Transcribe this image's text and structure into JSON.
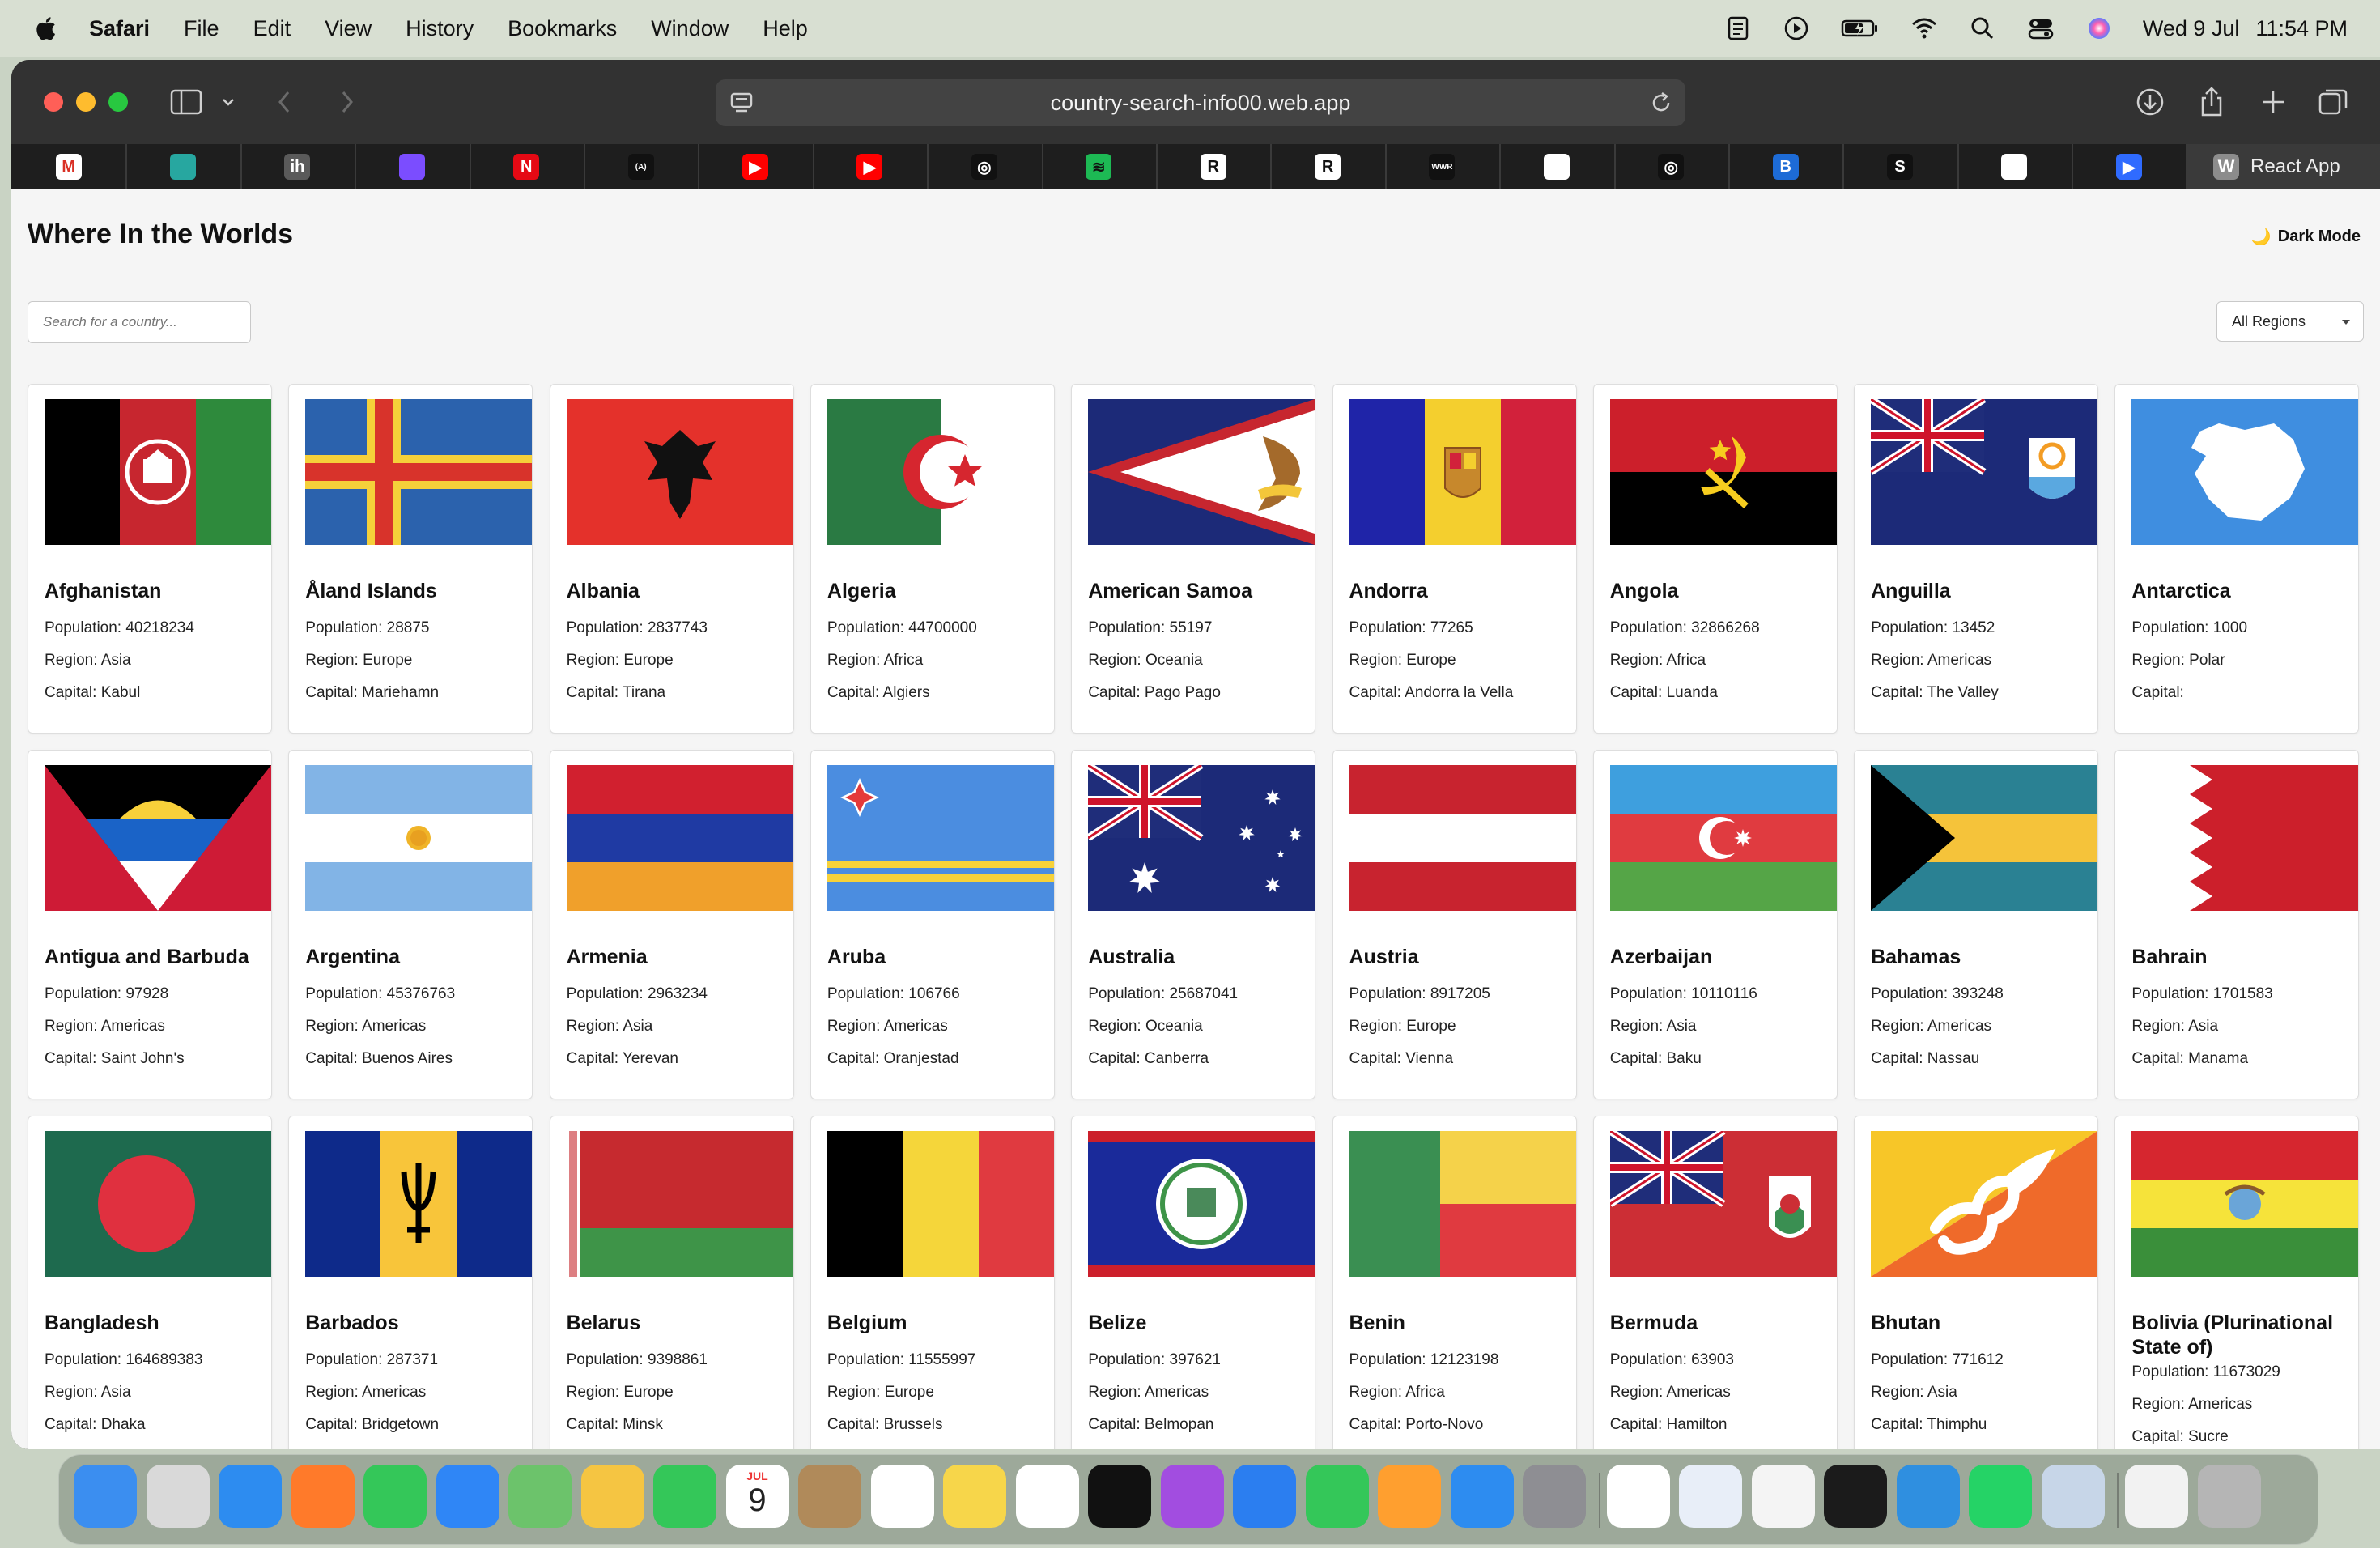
{
  "menubar": {
    "app_name": "Safari",
    "items": [
      "File",
      "Edit",
      "View",
      "History",
      "Bookmarks",
      "Window",
      "Help"
    ],
    "date": "Wed 9 Jul",
    "time": "11:54 PM"
  },
  "browser": {
    "url": "country-search-info00.web.app",
    "active_tab_title": "React App",
    "active_tab_icon_letter": "W",
    "favorite_tabs": [
      {
        "icon": "gmail-icon",
        "letter": "M",
        "color": "#ffffff",
        "text": "#d93025"
      },
      {
        "icon": "diamond-icon",
        "letter": "",
        "color": "#27a7a0",
        "text": "#fff"
      },
      {
        "icon": "ih-icon",
        "letter": "ih",
        "color": "#5a5a5a",
        "text": "#fff"
      },
      {
        "icon": "sparkle-icon",
        "letter": "",
        "color": "#7b4dff",
        "text": "#fff"
      },
      {
        "icon": "netflix-icon",
        "letter": "N",
        "color": "#e50914",
        "text": "#fff"
      },
      {
        "icon": "code-icon",
        "letter": "(A)",
        "color": "#111111",
        "text": "#fff"
      },
      {
        "icon": "youtube-icon",
        "letter": "▶",
        "color": "#ff0000",
        "text": "#fff"
      },
      {
        "icon": "youtube-icon",
        "letter": "▶",
        "color": "#ff0000",
        "text": "#fff"
      },
      {
        "icon": "openai-icon",
        "letter": "◎",
        "color": "#111111",
        "text": "#fff"
      },
      {
        "icon": "spotify-icon",
        "letter": "≋",
        "color": "#1db954",
        "text": "#111"
      },
      {
        "icon": "r-icon",
        "letter": "R",
        "color": "#ffffff",
        "text": "#111"
      },
      {
        "icon": "r-icon",
        "letter": "R",
        "color": "#ffffff",
        "text": "#111"
      },
      {
        "icon": "wwr-icon",
        "letter": "WWR",
        "color": "#111111",
        "text": "#fff"
      },
      {
        "icon": "page-icon",
        "letter": "",
        "color": "#ffffff",
        "text": "#111"
      },
      {
        "icon": "openai-icon",
        "letter": "◎",
        "color": "#111111",
        "text": "#fff"
      },
      {
        "icon": "b-icon",
        "letter": "B",
        "color": "#1d6bd6",
        "text": "#fff"
      },
      {
        "icon": "s-icon",
        "letter": "S",
        "color": "#111111",
        "text": "#fff"
      },
      {
        "icon": "page-icon",
        "letter": "",
        "color": "#ffffff",
        "text": "#111"
      },
      {
        "icon": "play-icon",
        "letter": "▶",
        "color": "#2f6bff",
        "text": "#fff"
      }
    ]
  },
  "page": {
    "title": "Where In the Worlds",
    "dark_mode_label": "Dark Mode",
    "search_placeholder": "Search for a country...",
    "region_filter": "All Regions"
  },
  "labels": {
    "population": "Population: ",
    "region": "Region: ",
    "capital": "Capital: "
  },
  "countries": [
    {
      "name": "Afghanistan",
      "population": "40218234",
      "region": "Asia",
      "capital": "Kabul",
      "flag": "afghanistan"
    },
    {
      "name": "Åland Islands",
      "population": "28875",
      "region": "Europe",
      "capital": "Mariehamn",
      "flag": "aland"
    },
    {
      "name": "Albania",
      "population": "2837743",
      "region": "Europe",
      "capital": "Tirana",
      "flag": "albania"
    },
    {
      "name": "Algeria",
      "population": "44700000",
      "region": "Africa",
      "capital": "Algiers",
      "flag": "algeria"
    },
    {
      "name": "American Samoa",
      "population": "55197",
      "region": "Oceania",
      "capital": "Pago Pago",
      "flag": "american-samoa"
    },
    {
      "name": "Andorra",
      "population": "77265",
      "region": "Europe",
      "capital": "Andorra la Vella",
      "flag": "andorra"
    },
    {
      "name": "Angola",
      "population": "32866268",
      "region": "Africa",
      "capital": "Luanda",
      "flag": "angola"
    },
    {
      "name": "Anguilla",
      "population": "13452",
      "region": "Americas",
      "capital": "The Valley",
      "flag": "anguilla"
    },
    {
      "name": "Antarctica",
      "population": "1000",
      "region": "Polar",
      "capital": "",
      "flag": "antarctica"
    },
    {
      "name": "Antigua and Barbuda",
      "population": "97928",
      "region": "Americas",
      "capital": "Saint John's",
      "flag": "antigua"
    },
    {
      "name": "Argentina",
      "population": "45376763",
      "region": "Americas",
      "capital": "Buenos Aires",
      "flag": "argentina"
    },
    {
      "name": "Armenia",
      "population": "2963234",
      "region": "Asia",
      "capital": "Yerevan",
      "flag": "armenia"
    },
    {
      "name": "Aruba",
      "population": "106766",
      "region": "Americas",
      "capital": "Oranjestad",
      "flag": "aruba"
    },
    {
      "name": "Australia",
      "population": "25687041",
      "region": "Oceania",
      "capital": "Canberra",
      "flag": "australia"
    },
    {
      "name": "Austria",
      "population": "8917205",
      "region": "Europe",
      "capital": "Vienna",
      "flag": "austria"
    },
    {
      "name": "Azerbaijan",
      "population": "10110116",
      "region": "Asia",
      "capital": "Baku",
      "flag": "azerbaijan"
    },
    {
      "name": "Bahamas",
      "population": "393248",
      "region": "Americas",
      "capital": "Nassau",
      "flag": "bahamas"
    },
    {
      "name": "Bahrain",
      "population": "1701583",
      "region": "Asia",
      "capital": "Manama",
      "flag": "bahrain"
    },
    {
      "name": "Bangladesh",
      "population": "164689383",
      "region": "Asia",
      "capital": "Dhaka",
      "flag": "bangladesh"
    },
    {
      "name": "Barbados",
      "population": "287371",
      "region": "Americas",
      "capital": "Bridgetown",
      "flag": "barbados"
    },
    {
      "name": "Belarus",
      "population": "9398861",
      "region": "Europe",
      "capital": "Minsk",
      "flag": "belarus"
    },
    {
      "name": "Belgium",
      "population": "11555997",
      "region": "Europe",
      "capital": "Brussels",
      "flag": "belgium"
    },
    {
      "name": "Belize",
      "population": "397621",
      "region": "Americas",
      "capital": "Belmopan",
      "flag": "belize"
    },
    {
      "name": "Benin",
      "population": "12123198",
      "region": "Africa",
      "capital": "Porto-Novo",
      "flag": "benin"
    },
    {
      "name": "Bermuda",
      "population": "63903",
      "region": "Americas",
      "capital": "Hamilton",
      "flag": "bermuda"
    },
    {
      "name": "Bhutan",
      "population": "771612",
      "region": "Asia",
      "capital": "Thimphu",
      "flag": "bhutan"
    },
    {
      "name": "Bolivia (Plurinational State of)",
      "population": "11673029",
      "region": "Americas",
      "capital": "Sucre",
      "flag": "bolivia"
    }
  ],
  "dock": {
    "apps": [
      {
        "name": "finder-icon",
        "color": "#3b8ef0"
      },
      {
        "name": "launchpad-icon",
        "color": "#d9d9d9"
      },
      {
        "name": "safari-icon",
        "color": "#2d8cf0"
      },
      {
        "name": "firefox-icon",
        "color": "#ff7a2a"
      },
      {
        "name": "messages-icon",
        "color": "#34c759"
      },
      {
        "name": "mail-icon",
        "color": "#2f86f6"
      },
      {
        "name": "maps-icon",
        "color": "#6cc36b"
      },
      {
        "name": "photos-icon",
        "color": "#f5c542"
      },
      {
        "name": "facetime-icon",
        "color": "#34c759"
      },
      {
        "name": "calendar-icon",
        "color": "#ffffff"
      },
      {
        "name": "contacts-icon",
        "color": "#b08a5a"
      },
      {
        "name": "reminders-icon",
        "color": "#ffffff"
      },
      {
        "name": "notes-icon",
        "color": "#f7d64a"
      },
      {
        "name": "freeform-icon",
        "color": "#ffffff"
      },
      {
        "name": "tv-icon",
        "color": "#111111"
      },
      {
        "name": "podcasts-icon",
        "color": "#a24de0"
      },
      {
        "name": "keynote-icon",
        "color": "#2b7ef0"
      },
      {
        "name": "numbers-icon",
        "color": "#34c759"
      },
      {
        "name": "pages-icon",
        "color": "#ff9f2f"
      },
      {
        "name": "app-store-icon",
        "color": "#2d8cf0"
      },
      {
        "name": "system-settings-icon",
        "color": "#8e8e93"
      },
      {
        "name": "chrome-icon",
        "color": "#ffffff"
      },
      {
        "name": "preview-icon",
        "color": "#e8eef8"
      },
      {
        "name": "textedit-icon",
        "color": "#f4f4f4"
      },
      {
        "name": "terminal-icon",
        "color": "#1b1b1b"
      },
      {
        "name": "vscode-icon",
        "color": "#2f8fe0"
      },
      {
        "name": "whatsapp-icon",
        "color": "#25d366"
      },
      {
        "name": "image-viewer-icon",
        "color": "#c7d6e8"
      },
      {
        "name": "documents-icon",
        "color": "#f2f2f2"
      },
      {
        "name": "trash-icon",
        "color": "#b5b5b5"
      }
    ],
    "calendar_month": "JUL",
    "calendar_day": "9"
  }
}
